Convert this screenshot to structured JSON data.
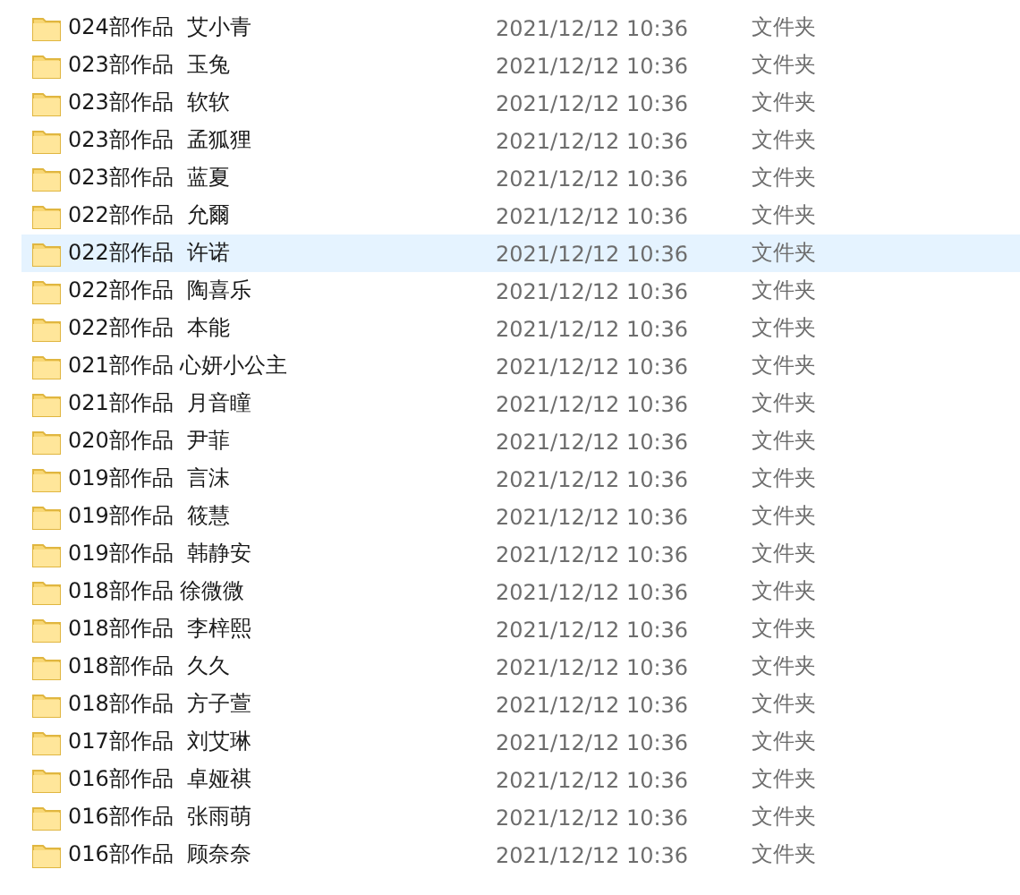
{
  "files": [
    {
      "name": "024部作品  艾小青",
      "modified": "2021/12/12 10:36",
      "type": "文件夹",
      "selected": false
    },
    {
      "name": "023部作品  玉兔",
      "modified": "2021/12/12 10:36",
      "type": "文件夹",
      "selected": false
    },
    {
      "name": "023部作品  软软",
      "modified": "2021/12/12 10:36",
      "type": "文件夹",
      "selected": false
    },
    {
      "name": "023部作品  孟狐狸",
      "modified": "2021/12/12 10:36",
      "type": "文件夹",
      "selected": false
    },
    {
      "name": "023部作品  蓝夏",
      "modified": "2021/12/12 10:36",
      "type": "文件夹",
      "selected": false
    },
    {
      "name": "022部作品  允爾",
      "modified": "2021/12/12 10:36",
      "type": "文件夹",
      "selected": false
    },
    {
      "name": "022部作品  许诺",
      "modified": "2021/12/12 10:36",
      "type": "文件夹",
      "selected": true
    },
    {
      "name": "022部作品  陶喜乐",
      "modified": "2021/12/12 10:36",
      "type": "文件夹",
      "selected": false
    },
    {
      "name": "022部作品  本能",
      "modified": "2021/12/12 10:36",
      "type": "文件夹",
      "selected": false
    },
    {
      "name": "021部作品 心妍小公主",
      "modified": "2021/12/12 10:36",
      "type": "文件夹",
      "selected": false
    },
    {
      "name": "021部作品  月音瞳",
      "modified": "2021/12/12 10:36",
      "type": "文件夹",
      "selected": false
    },
    {
      "name": "020部作品  尹菲",
      "modified": "2021/12/12 10:36",
      "type": "文件夹",
      "selected": false
    },
    {
      "name": "019部作品  言沫",
      "modified": "2021/12/12 10:36",
      "type": "文件夹",
      "selected": false
    },
    {
      "name": "019部作品  筱慧",
      "modified": "2021/12/12 10:36",
      "type": "文件夹",
      "selected": false
    },
    {
      "name": "019部作品  韩静安",
      "modified": "2021/12/12 10:36",
      "type": "文件夹",
      "selected": false
    },
    {
      "name": "018部作品 徐微微",
      "modified": "2021/12/12 10:36",
      "type": "文件夹",
      "selected": false
    },
    {
      "name": "018部作品  李梓熙",
      "modified": "2021/12/12 10:36",
      "type": "文件夹",
      "selected": false
    },
    {
      "name": "018部作品  久久",
      "modified": "2021/12/12 10:36",
      "type": "文件夹",
      "selected": false
    },
    {
      "name": "018部作品  方子萱",
      "modified": "2021/12/12 10:36",
      "type": "文件夹",
      "selected": false
    },
    {
      "name": "017部作品  刘艾琳",
      "modified": "2021/12/12 10:36",
      "type": "文件夹",
      "selected": false
    },
    {
      "name": "016部作品  卓娅祺",
      "modified": "2021/12/12 10:36",
      "type": "文件夹",
      "selected": false
    },
    {
      "name": "016部作品  张雨萌",
      "modified": "2021/12/12 10:36",
      "type": "文件夹",
      "selected": false
    },
    {
      "name": "016部作品  顾奈奈",
      "modified": "2021/12/12 10:36",
      "type": "文件夹",
      "selected": false
    }
  ]
}
